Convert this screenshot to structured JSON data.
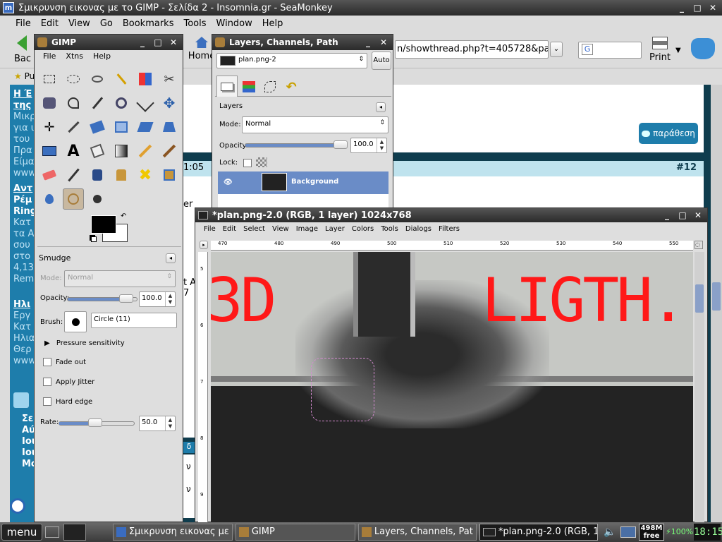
{
  "browser": {
    "title": "Σμικρυνση εικονας με το GIMP - Σελίδα 2 - Insomnia.gr - SeaMonkey",
    "menus": [
      "File",
      "Edit",
      "View",
      "Go",
      "Bookmarks",
      "Tools",
      "Window",
      "Help"
    ],
    "back_label": "Bac",
    "home_label": "Home",
    "url": "n/showthread.php?t=405728&page",
    "search_icon_text": "G",
    "print_label": "Print",
    "bookmark_label": "Pu"
  },
  "forum": {
    "left_links": [
      {
        "title": "Η Έ",
        "sub": "της"
      },
      {
        "lines": [
          "Μικρ",
          "για ι",
          "του",
          "Πρα",
          "Είμα",
          "www"
        ]
      }
    ],
    "left_links2": {
      "title": "Αντ",
      "sub1": "Ρέμ",
      "sub2": "Ring",
      "lines": [
        "Κατ",
        "τα Α",
        "σου",
        "στο",
        "4,13",
        "Rem"
      ]
    },
    "left_links3": {
      "title": "Ηλι",
      "lines": [
        "Εργ",
        "Κατ",
        "Ηλια",
        "Θερ",
        "www"
      ]
    },
    "left_bottom": [
      "Σε",
      "Αύ",
      "Ιου",
      "Ιου",
      "Μο"
    ],
    "quote_button": "παράθεση",
    "post_time": "1:05",
    "post_number": "#12",
    "frag1": "er",
    "frag2": "t A",
    "frag3": "7",
    "frag4": "ν",
    "frag5": "ν",
    "frag6": "δ"
  },
  "gimp_toolbox": {
    "title": "GIMP",
    "menus": [
      "File",
      "Xtns",
      "Help"
    ],
    "tool_options_title": "Smudge",
    "mode_label": "Mode:",
    "mode_value": "Normal",
    "opacity_label": "Opacity:",
    "opacity_value": "100.0",
    "brush_label": "Brush:",
    "brush_value": "Circle (11)",
    "pressure_label": "Pressure sensitivity",
    "fade_label": "Fade out",
    "jitter_label": "Apply Jitter",
    "hard_label": "Hard edge",
    "rate_label": "Rate:",
    "rate_value": "50.0",
    "rate_fraction": 0.5
  },
  "layers_dialog": {
    "title": "Layers, Channels, Path",
    "image_select": "plan.png-2",
    "auto_label": "Auto",
    "section": "Layers",
    "mode_label": "Mode:",
    "mode_value": "Normal",
    "opacity_label": "Opacity:",
    "opacity_value": "100.0",
    "lock_label": "Lock:",
    "layer_name": "Background"
  },
  "image_window": {
    "title": "*plan.png-2.0 (RGB, 1 layer) 1024x768",
    "menus": [
      "File",
      "Edit",
      "Select",
      "View",
      "Image",
      "Layer",
      "Colors",
      "Tools",
      "Dialogs",
      "Filters"
    ],
    "ruler_ticks": [
      "470",
      "480",
      "490",
      "500",
      "510",
      "520",
      "530",
      "540",
      "550"
    ],
    "vruler_ticks": [
      "5",
      "6",
      "7",
      "8",
      "9"
    ],
    "canvas_text_left": "3D",
    "canvas_text_right": "LIGTH."
  },
  "taskbar": {
    "menu_label": "menu",
    "items": [
      "Σμικρυνση εικονας με",
      "GIMP",
      "Layers, Channels, Pat",
      "*plan.png-2.0 (RGB, 1"
    ],
    "mem": "498M",
    "mem_sub": "free",
    "battery": "100%",
    "clock": "18:15"
  },
  "colors": {
    "accent": "#1e7dab",
    "title_bg": "#2b2b2b",
    "active": "#4a6fa5"
  }
}
